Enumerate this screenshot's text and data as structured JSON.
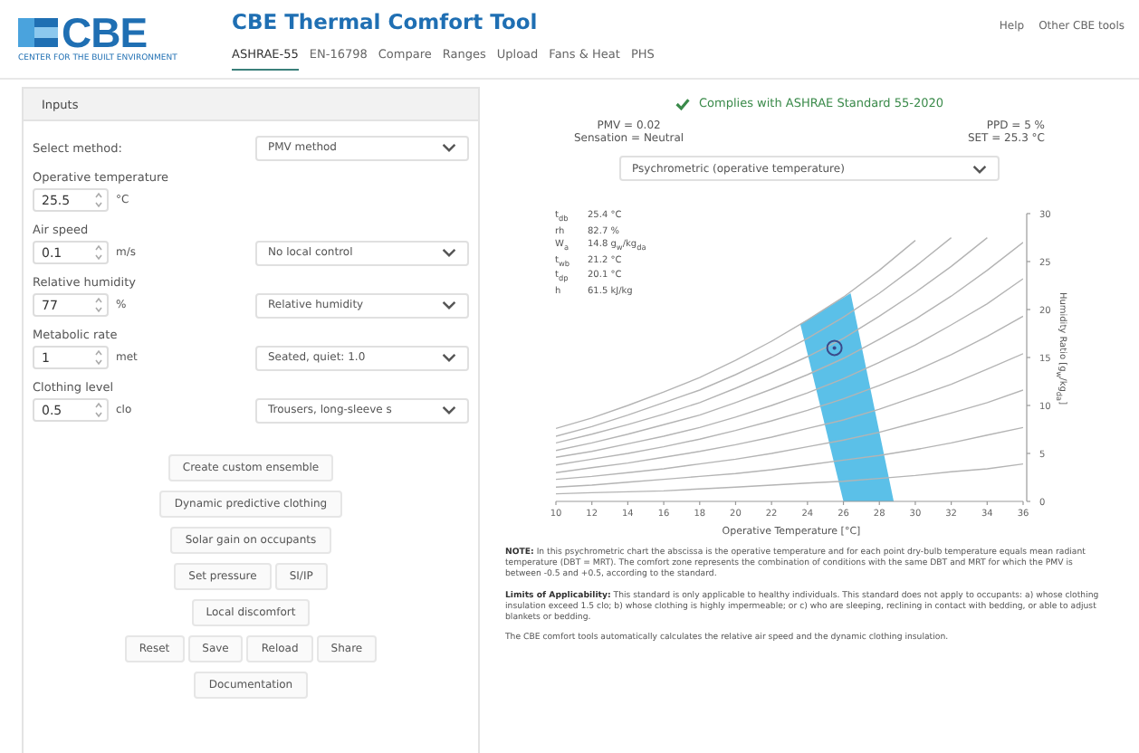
{
  "header": {
    "logo": "CBE",
    "logo_tagline": "CENTER FOR THE BUILT ENVIRONMENT",
    "title": "CBE Thermal Comfort Tool",
    "links": [
      "Help",
      "Other CBE tools"
    ],
    "tabs": [
      {
        "label": "ASHRAE-55",
        "selected": true
      },
      {
        "label": "EN-16798",
        "selected": false
      },
      {
        "label": "Compare",
        "selected": false
      },
      {
        "label": "Ranges",
        "selected": false
      },
      {
        "label": "Upload",
        "selected": false
      },
      {
        "label": "Fans & Heat",
        "selected": false
      },
      {
        "label": "PHS",
        "selected": false
      }
    ]
  },
  "inputs": {
    "title": "Inputs",
    "method": {
      "label": "Select method:",
      "value": "PMV method"
    },
    "fields": [
      {
        "label": "Operative temperature",
        "value": "25.5",
        "unit": "°C"
      },
      {
        "label": "Air speed",
        "value": "0.1",
        "unit": "m/s",
        "select": "No local control"
      },
      {
        "label": "Relative humidity",
        "value": "77",
        "unit": "%",
        "select": "Relative humidity"
      },
      {
        "label": "Metabolic rate",
        "value": "1",
        "unit": "met",
        "select": "Seated, quiet: 1.0"
      },
      {
        "label": "Clothing level",
        "value": "0.5",
        "unit": "clo",
        "select": "Trousers, long-sleeve s"
      }
    ],
    "button_rows": [
      [
        "Create custom ensemble"
      ],
      [
        "Dynamic predictive clothing"
      ],
      [
        "Solar gain on occupants"
      ],
      [
        "Set pressure",
        "SI/IP"
      ],
      [
        "Local discomfort"
      ],
      [
        "Reset",
        "Save",
        "Reload",
        "Share"
      ],
      [
        "Documentation"
      ]
    ]
  },
  "results": {
    "compliance": "Complies with ASHRAE Standard 55-2020",
    "pmv": "PMV = 0.02",
    "sensation": "Sensation = Neutral",
    "ppd": "PPD = 5 %",
    "set": "SET = 25.3 °C",
    "chart_select": "Psychrometric (operative temperature)",
    "readout": [
      {
        "label": "t$_{db}$",
        "value": "25.4 °C"
      },
      {
        "label": "rh",
        "value": "82.7 %"
      },
      {
        "label": "W$_{a}$",
        "value": "14.8 g$_{w}$/kg$_{da}$"
      },
      {
        "label": "t$_{wb}$",
        "value": "21.2 °C"
      },
      {
        "label": "t$_{dp}$",
        "value": "20.1 °C"
      },
      {
        "label": "h",
        "value": "61.5 kJ/kg"
      }
    ],
    "chart_data": {
      "type": "line",
      "xlabel": "Operative Temperature [°C]",
      "ylabel": "Humidity Ratio [g$_{w}$/kg$_{da}$]",
      "x": [
        10,
        12,
        14,
        16,
        18,
        20,
        22,
        24,
        26,
        28,
        30,
        32,
        34,
        36
      ],
      "xlim": [
        10,
        36
      ],
      "ylim": [
        0,
        30
      ],
      "xticks": [
        10,
        12,
        14,
        16,
        18,
        20,
        22,
        24,
        26,
        28,
        30,
        32,
        34,
        36
      ],
      "yticks": [
        0,
        5,
        10,
        15,
        20,
        25,
        30
      ],
      "series": [
        {
          "color": "#b4b4b4",
          "values": [
            0.8,
            0.9,
            1.0,
            1.1,
            1.3,
            1.5,
            1.7,
            1.9,
            2.1,
            2.4,
            2.7,
            3.1,
            3.4,
            3.9
          ]
        },
        {
          "color": "#b4b4b4",
          "values": [
            1.5,
            1.7,
            2.0,
            2.3,
            2.6,
            2.9,
            3.3,
            3.8,
            4.3,
            4.8,
            5.4,
            6.1,
            6.9,
            7.7
          ]
        },
        {
          "color": "#b4b4b4",
          "values": [
            2.3,
            2.6,
            3.0,
            3.4,
            3.9,
            4.4,
            5.0,
            5.7,
            6.4,
            7.2,
            8.2,
            9.2,
            10.3,
            11.6
          ]
        },
        {
          "color": "#b4b4b4",
          "values": [
            3.0,
            3.5,
            4.0,
            4.6,
            5.2,
            5.9,
            6.7,
            7.6,
            8.5,
            9.6,
            10.9,
            12.2,
            13.8,
            15.4
          ]
        },
        {
          "color": "#b4b4b4",
          "values": [
            3.8,
            4.4,
            5.0,
            5.7,
            6.5,
            7.4,
            8.4,
            9.5,
            10.7,
            12.1,
            13.6,
            15.3,
            17.2,
            19.3
          ]
        },
        {
          "color": "#b4b4b4",
          "values": [
            4.6,
            5.2,
            6.0,
            6.8,
            7.7,
            8.8,
            10.0,
            11.3,
            12.8,
            14.5,
            16.3,
            18.4,
            20.6,
            23.2
          ]
        },
        {
          "color": "#b4b4b4",
          "values": [
            5.3,
            6.1,
            7.0,
            8.0,
            9.0,
            10.3,
            11.7,
            13.2,
            14.9,
            16.9,
            19.0,
            21.4,
            24.1,
            27.0
          ]
        },
        {
          "color": "#b4b4b4",
          "values": [
            6.1,
            7.0,
            8.0,
            9.1,
            10.3,
            11.8,
            13.4,
            15.1,
            17.0,
            19.3,
            21.8,
            24.5,
            27.5,
            null
          ]
        },
        {
          "color": "#b4b4b4",
          "values": [
            6.8,
            7.8,
            9.0,
            10.3,
            11.6,
            13.2,
            15.0,
            17.0,
            19.2,
            21.7,
            24.5,
            27.5,
            null,
            null
          ]
        },
        {
          "color": "#b4b4b4",
          "values": [
            7.6,
            8.7,
            10.0,
            11.4,
            12.9,
            14.7,
            16.7,
            18.9,
            21.3,
            24.1,
            27.2,
            null,
            null,
            null
          ]
        }
      ]
    },
    "notes": [
      "**NOTE:** In this psychrometric chart the abscissa is the operative temperature and for each point dry-bulb temperature equals mean radiant temperature (DBT = MRT). The comfort zone represents the combination of conditions with the same DBT and MRT for which the PMV is between -0.5 and +0.5, according to the standard.",
      "**Limits of Applicability:** This standard is only applicable to healthy individuals. This standard does not apply to occupants: a) whose clothing insulation exceed 1.5 clo; b) whose clothing is highly impermeable; or c) who are sleeping, reclining in contact with bedding, or able to adjust blankets or bedding.",
      "The CBE comfort tools automatically calculates the relative air speed and the dynamic clothing insulation."
    ]
  }
}
